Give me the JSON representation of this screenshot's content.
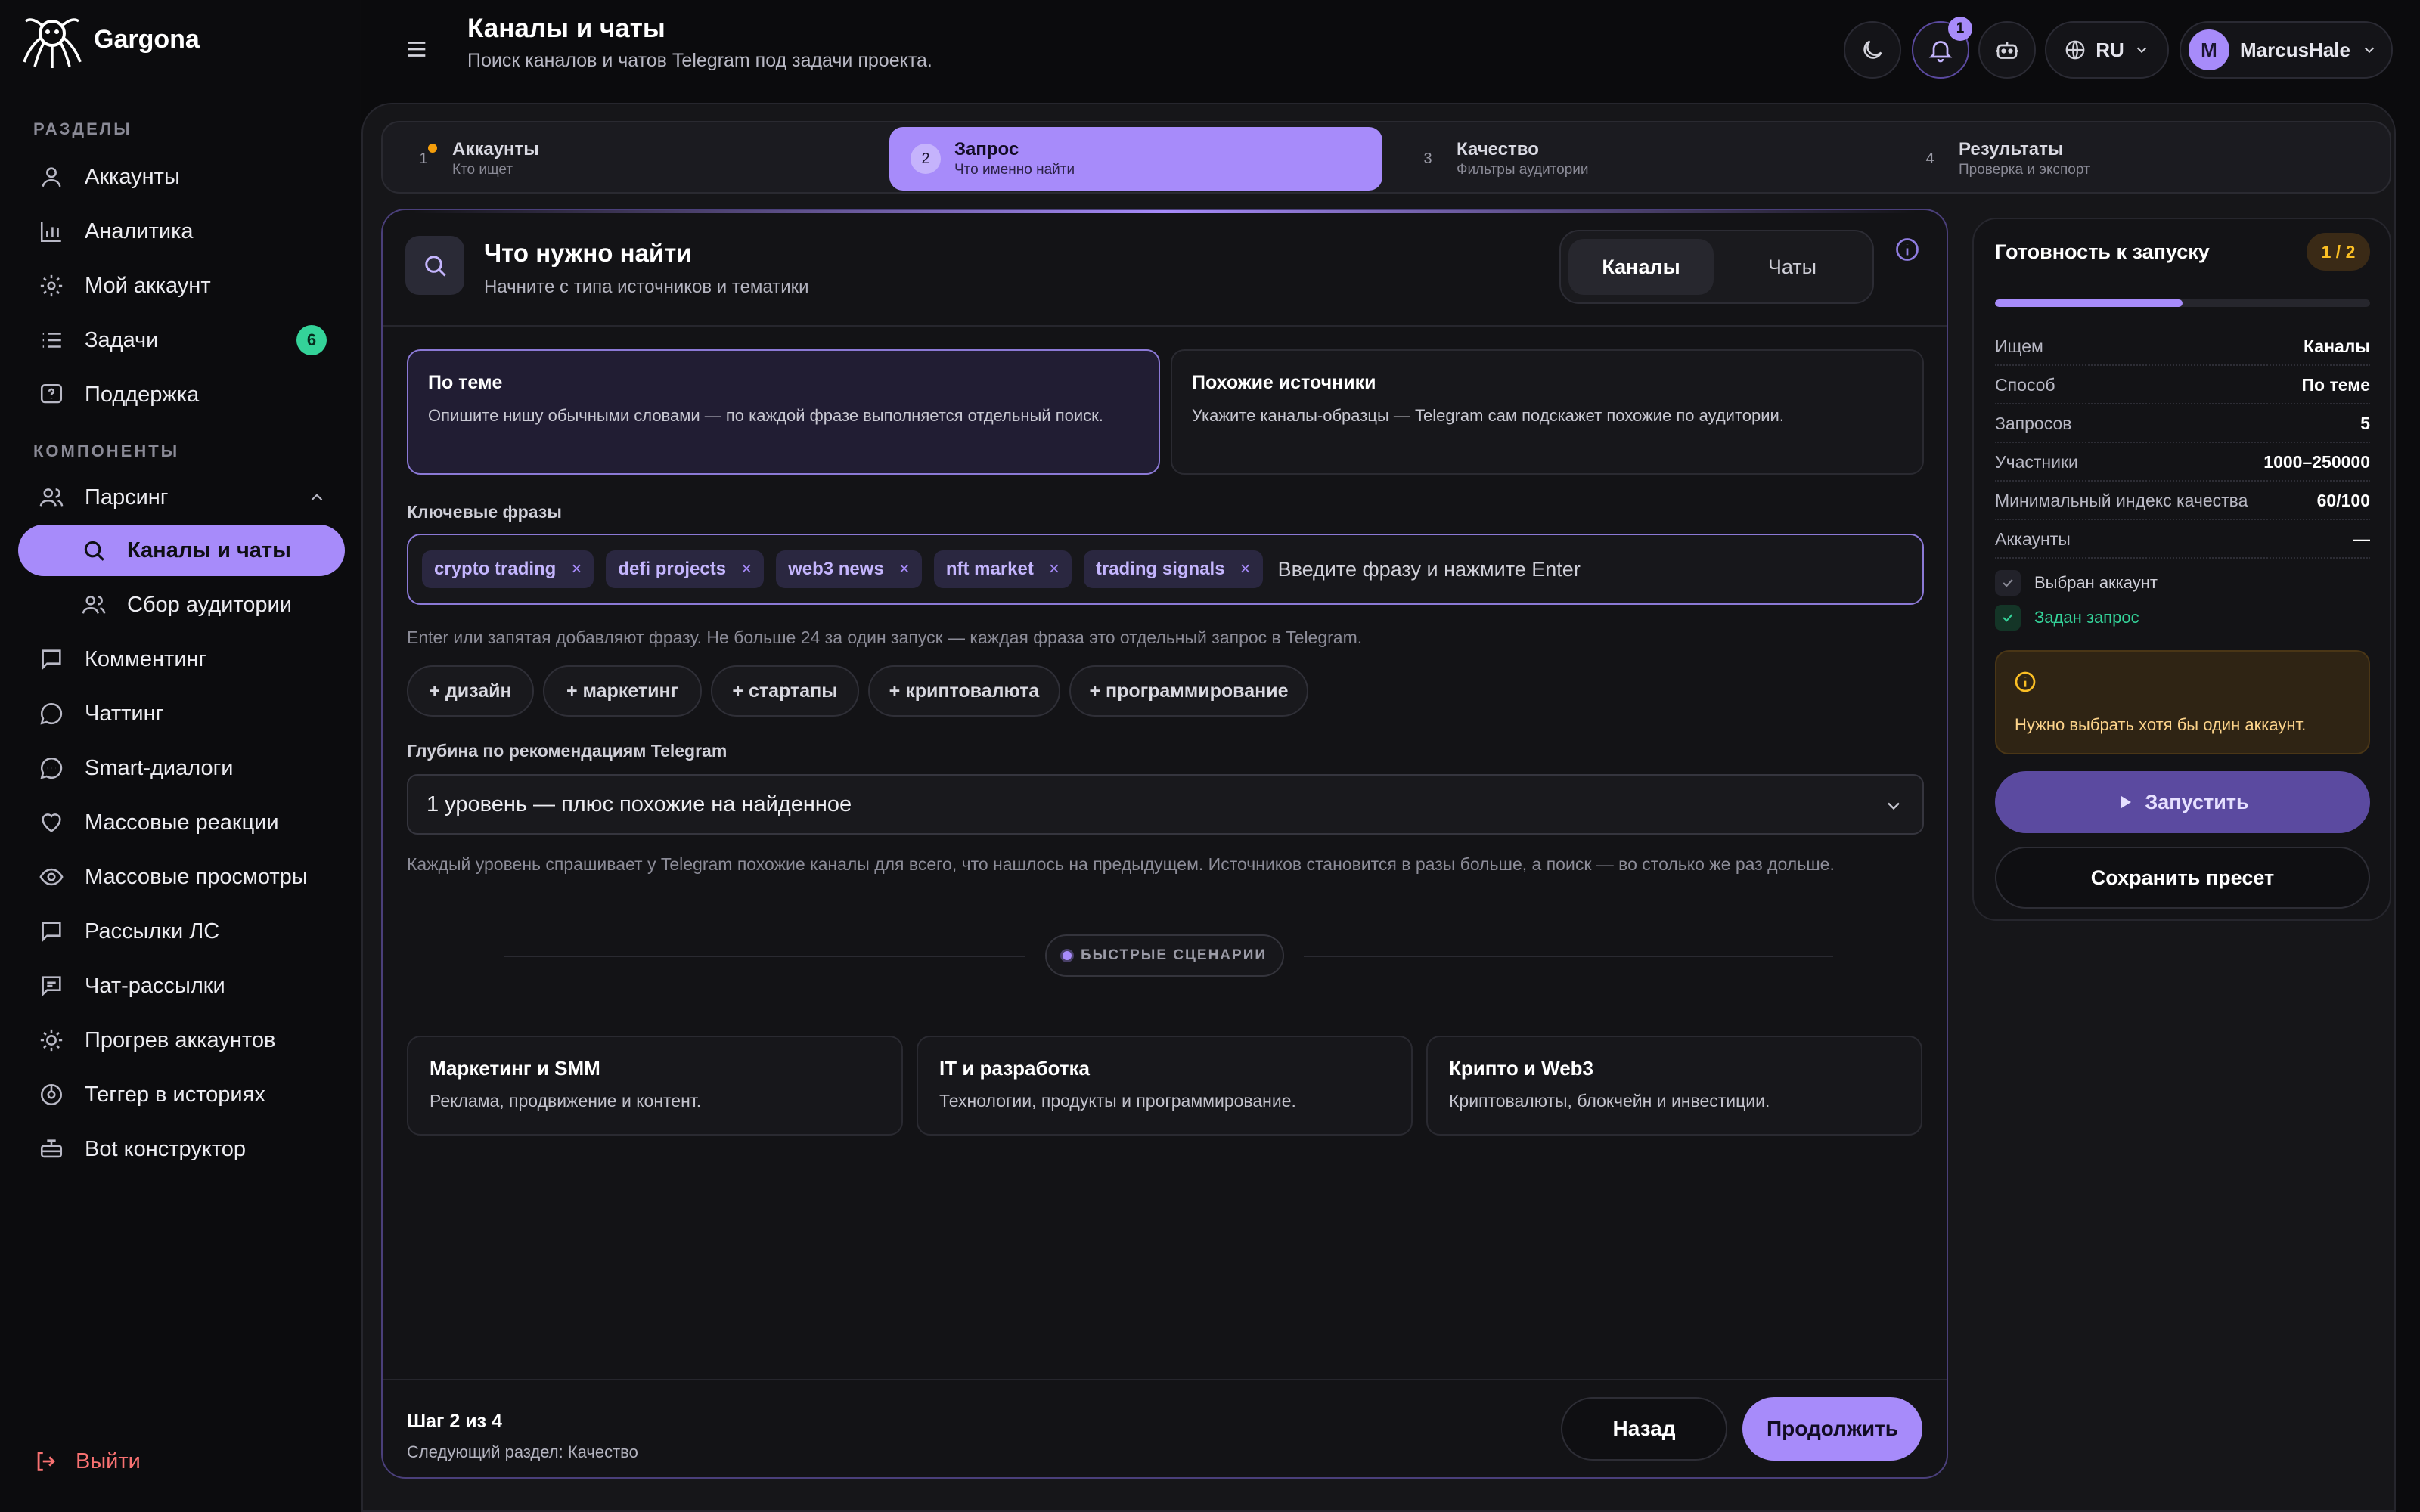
{
  "app": {
    "name": "Gargona"
  },
  "sidebar": {
    "section_main": "РАЗДЕЛЫ",
    "section_components": "КОМПОНЕНТЫ",
    "items": [
      {
        "label": "Аккаунты",
        "icon": "user-icon"
      },
      {
        "label": "Аналитика",
        "icon": "chart-icon"
      },
      {
        "label": "Мой аккаунт",
        "icon": "gear-icon"
      },
      {
        "label": "Задачи",
        "icon": "list-icon",
        "badge": "6"
      },
      {
        "label": "Поддержка",
        "icon": "help-icon"
      }
    ],
    "parsing": {
      "label": "Парсинг",
      "icon": "users-icon"
    },
    "sub_items": [
      {
        "label": "Каналы и чаты",
        "icon": "search-icon"
      },
      {
        "label": "Сбор аудитории",
        "icon": "users-icon"
      }
    ],
    "more": [
      {
        "label": "Комментинг",
        "icon": "comment-icon"
      },
      {
        "label": "Чаттинг",
        "icon": "chat-icon"
      },
      {
        "label": "Smart-диалоги",
        "icon": "dialog-icon"
      },
      {
        "label": "Массовые реакции",
        "icon": "heart-icon"
      },
      {
        "label": "Массовые просмотры",
        "icon": "eye-icon"
      },
      {
        "label": "Рассылки ЛС",
        "icon": "message-icon"
      },
      {
        "label": "Чат-рассылки",
        "icon": "chat-list-icon"
      },
      {
        "label": "Прогрев аккаунтов",
        "icon": "sun-icon"
      },
      {
        "label": "Теггер в историях",
        "icon": "tag-icon"
      },
      {
        "label": "Bot конструктор",
        "icon": "bot-icon"
      }
    ],
    "logout": "Выйти"
  },
  "header": {
    "title": "Каналы и чаты",
    "subtitle": "Поиск каналов и чатов Telegram под задачи проекта.",
    "notifications_count": "1",
    "language": "RU",
    "user_initial": "M",
    "user_name": "MarcusHale"
  },
  "stepper": [
    {
      "num": "1",
      "label": "Аккаунты",
      "hint": "Кто ищет"
    },
    {
      "num": "2",
      "label": "Запрос",
      "hint": "Что именно найти"
    },
    {
      "num": "3",
      "label": "Качество",
      "hint": "Фильтры аудитории"
    },
    {
      "num": "4",
      "label": "Результаты",
      "hint": "Проверка и экспорт"
    }
  ],
  "form": {
    "title": "Что нужно найти",
    "subtitle": "Начните с типа источников и тематики",
    "segment": {
      "channels": "Каналы",
      "chats": "Чаты"
    },
    "options": [
      {
        "title": "По теме",
        "desc": "Опишите нишу обычными словами — по каждой фразе выполняется отдельный поиск."
      },
      {
        "title": "Похожие источники",
        "desc": "Укажите каналы-образцы — Telegram сам подскажет похожие по аудитории."
      }
    ],
    "keywords_label": "Ключевые фразы",
    "tags": [
      "crypto trading",
      "defi projects",
      "web3 news",
      "nft market",
      "trading signals"
    ],
    "tag_placeholder": "Введите фразу и нажмите Enter",
    "keywords_help": "Enter или запятая добавляют фразу. Не больше 24 за один запуск — каждая фраза это отдельный запрос в Telegram.",
    "suggestions": [
      "+ дизайн",
      "+ маркетинг",
      "+ стартапы",
      "+ криптовалюта",
      "+ программирование"
    ],
    "depth_label": "Глубина по рекомендациям Telegram",
    "depth_value": "1 уровень — плюс похожие на найденное",
    "depth_help": "Каждый уровень спрашивает у Telegram похожие каналы для всего, что нашлось на предыдущем. Источников становится в разы больше, а поиск — во столько же раз дольше.",
    "scenarios_label": "БЫСТРЫЕ СЦЕНАРИИ",
    "scenarios": [
      {
        "title": "Маркетинг и SMM",
        "desc": "Реклама, продвижение и контент."
      },
      {
        "title": "IT и разработка",
        "desc": "Технологии, продукты и программирование."
      },
      {
        "title": "Крипто и Web3",
        "desc": "Криптовалюты, блокчейн и инвестиции."
      }
    ],
    "footer": {
      "step_of": "Шаг 2 из 4",
      "next_section": "Следующий раздел: Качество",
      "back": "Назад",
      "next": "Продолжить"
    }
  },
  "readiness": {
    "title": "Готовность к запуску",
    "count": "1 / 2",
    "progress": 0.5,
    "rows": [
      {
        "k": "Ищем",
        "v": "Каналы"
      },
      {
        "k": "Способ",
        "v": "По теме"
      },
      {
        "k": "Запросов",
        "v": "5"
      },
      {
        "k": "Участники",
        "v": "1000–250000"
      },
      {
        "k": "Минимальный индекс качества",
        "v": "60/100"
      },
      {
        "k": "Аккаунты",
        "v": "—"
      }
    ],
    "checks": [
      {
        "label": "Выбран аккаунт",
        "done": false
      },
      {
        "label": "Задан запрос",
        "done": true
      }
    ],
    "warning": "Нужно выбрать хотя бы один аккаунт.",
    "run": "Запустить",
    "save_preset": "Сохранить пресет"
  },
  "colors": {
    "accent": "#a78bfa",
    "success": "#34d399",
    "warning": "#fbbf24",
    "danger": "#f87171"
  }
}
